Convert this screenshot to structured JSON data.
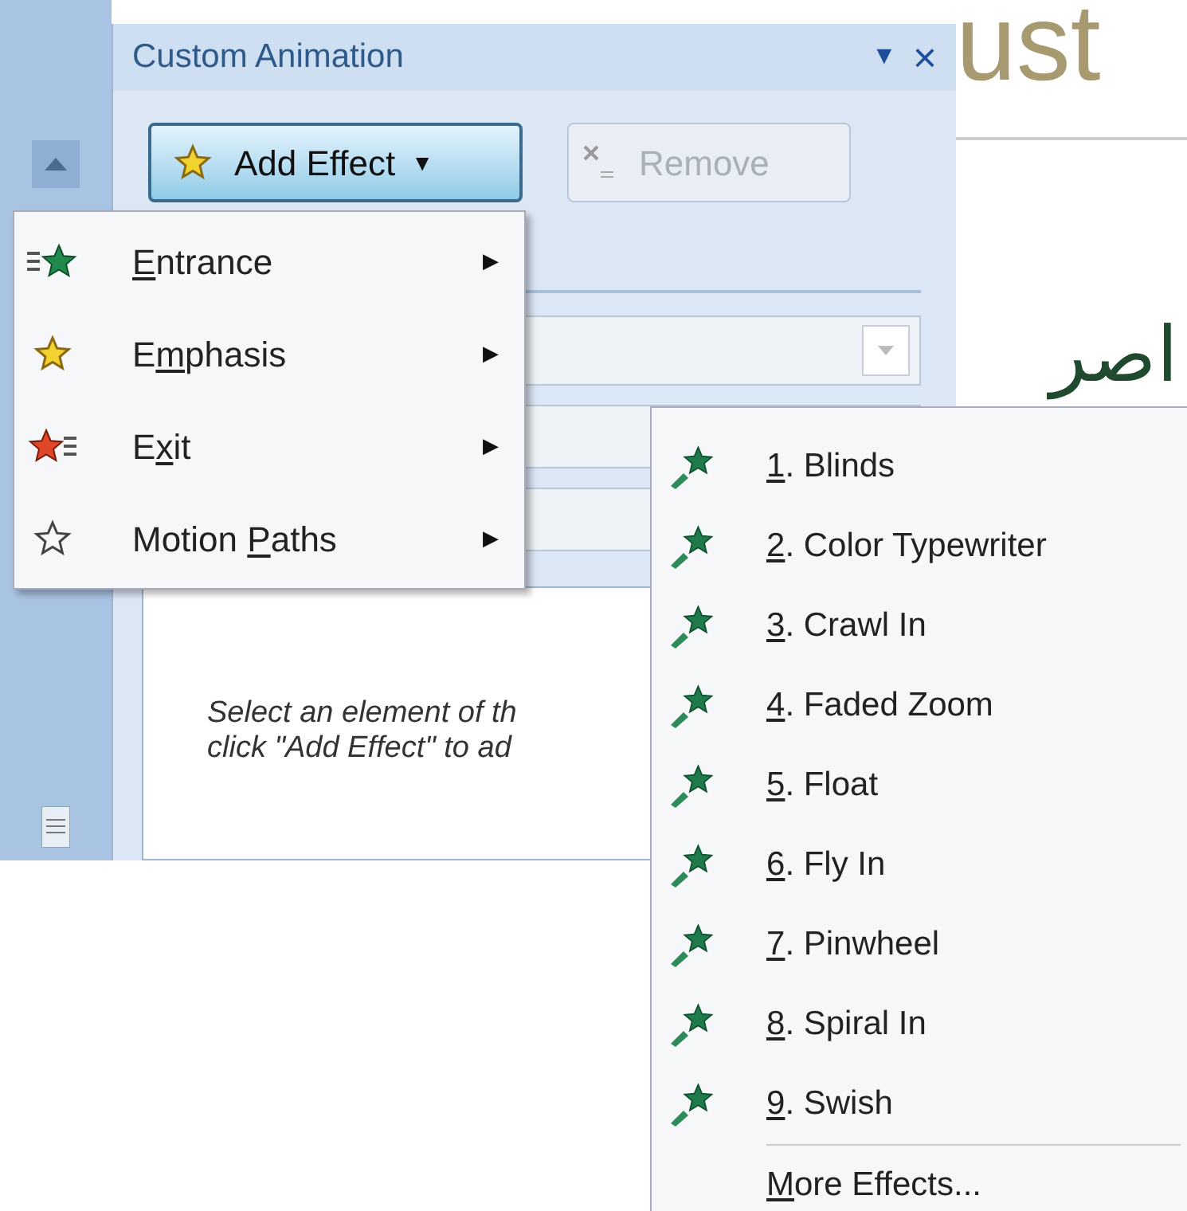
{
  "slide": {
    "title_fragment": "ust",
    "arabic_fragment": "اصر"
  },
  "pane": {
    "title": "Custom Animation",
    "menu_glyph": "▼",
    "close_glyph": "×",
    "add_effect": {
      "label": "Add Effect",
      "caret": "▼"
    },
    "remove": {
      "label": "Remove",
      "disabled": true
    },
    "hint_lines": [
      "Select an element of th",
      "click \"Add Effect\" to ad"
    ]
  },
  "menu": [
    {
      "kind": "entrance",
      "key": "E",
      "after": "ntrance",
      "arrow": "▶"
    },
    {
      "kind": "emphasis",
      "before": "E",
      "key": "m",
      "after": "phasis",
      "arrow": "▶"
    },
    {
      "kind": "exit",
      "before": "E",
      "key": "x",
      "after": "it",
      "arrow": "▶"
    },
    {
      "kind": "motion",
      "before": "Motion ",
      "key": "P",
      "after": "aths",
      "arrow": "▶"
    }
  ],
  "submenu": {
    "items": [
      {
        "key": "1",
        "after": ". Blinds"
      },
      {
        "key": "2",
        "after": ". Color Typewriter"
      },
      {
        "key": "3",
        "after": ". Crawl In"
      },
      {
        "key": "4",
        "after": ". Faded Zoom"
      },
      {
        "key": "5",
        "after": ". Float"
      },
      {
        "key": "6",
        "after": ". Fly In"
      },
      {
        "key": "7",
        "after": ". Pinwheel"
      },
      {
        "key": "8",
        "after": ". Spiral In"
      },
      {
        "key": "9",
        "after": ". Swish"
      }
    ],
    "more": {
      "key": "M",
      "after": "ore Effects..."
    }
  }
}
